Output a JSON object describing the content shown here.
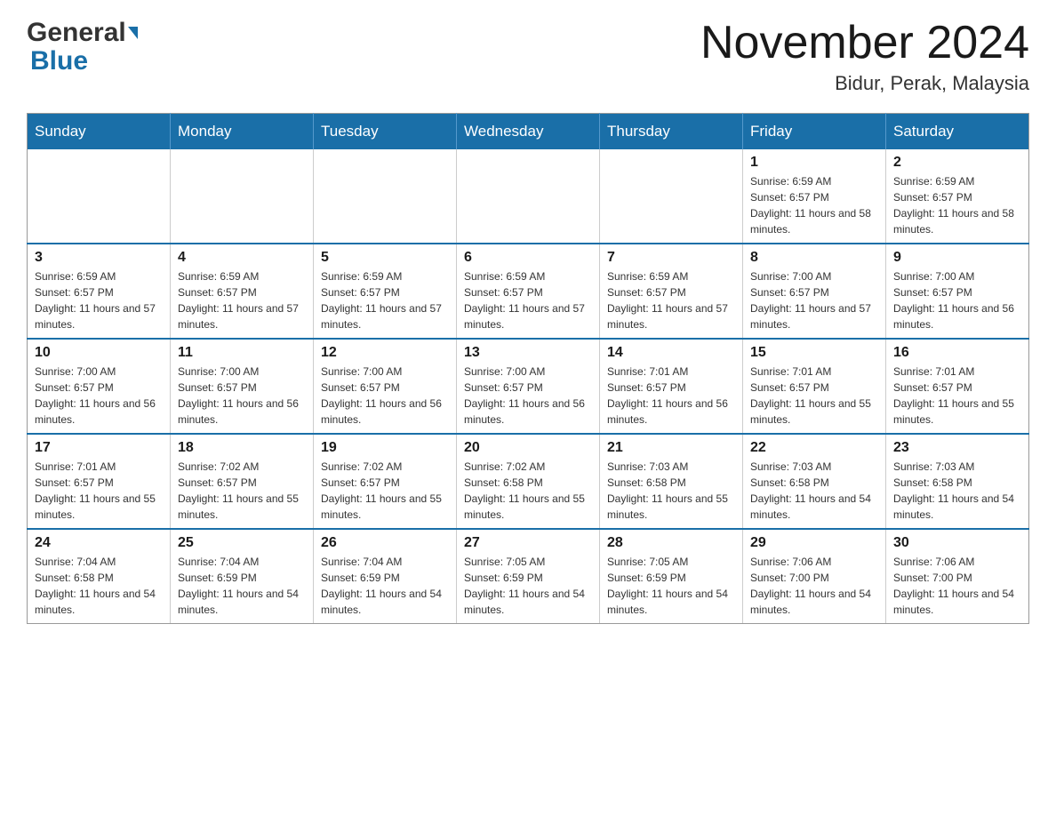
{
  "header": {
    "logo_general": "General",
    "logo_blue": "Blue",
    "month_title": "November 2024",
    "location": "Bidur, Perak, Malaysia"
  },
  "days_of_week": [
    "Sunday",
    "Monday",
    "Tuesday",
    "Wednesday",
    "Thursday",
    "Friday",
    "Saturday"
  ],
  "weeks": [
    [
      {
        "day": "",
        "sunrise": "",
        "sunset": "",
        "daylight": ""
      },
      {
        "day": "",
        "sunrise": "",
        "sunset": "",
        "daylight": ""
      },
      {
        "day": "",
        "sunrise": "",
        "sunset": "",
        "daylight": ""
      },
      {
        "day": "",
        "sunrise": "",
        "sunset": "",
        "daylight": ""
      },
      {
        "day": "",
        "sunrise": "",
        "sunset": "",
        "daylight": ""
      },
      {
        "day": "1",
        "sunrise": "Sunrise: 6:59 AM",
        "sunset": "Sunset: 6:57 PM",
        "daylight": "Daylight: 11 hours and 58 minutes."
      },
      {
        "day": "2",
        "sunrise": "Sunrise: 6:59 AM",
        "sunset": "Sunset: 6:57 PM",
        "daylight": "Daylight: 11 hours and 58 minutes."
      }
    ],
    [
      {
        "day": "3",
        "sunrise": "Sunrise: 6:59 AM",
        "sunset": "Sunset: 6:57 PM",
        "daylight": "Daylight: 11 hours and 57 minutes."
      },
      {
        "day": "4",
        "sunrise": "Sunrise: 6:59 AM",
        "sunset": "Sunset: 6:57 PM",
        "daylight": "Daylight: 11 hours and 57 minutes."
      },
      {
        "day": "5",
        "sunrise": "Sunrise: 6:59 AM",
        "sunset": "Sunset: 6:57 PM",
        "daylight": "Daylight: 11 hours and 57 minutes."
      },
      {
        "day": "6",
        "sunrise": "Sunrise: 6:59 AM",
        "sunset": "Sunset: 6:57 PM",
        "daylight": "Daylight: 11 hours and 57 minutes."
      },
      {
        "day": "7",
        "sunrise": "Sunrise: 6:59 AM",
        "sunset": "Sunset: 6:57 PM",
        "daylight": "Daylight: 11 hours and 57 minutes."
      },
      {
        "day": "8",
        "sunrise": "Sunrise: 7:00 AM",
        "sunset": "Sunset: 6:57 PM",
        "daylight": "Daylight: 11 hours and 57 minutes."
      },
      {
        "day": "9",
        "sunrise": "Sunrise: 7:00 AM",
        "sunset": "Sunset: 6:57 PM",
        "daylight": "Daylight: 11 hours and 56 minutes."
      }
    ],
    [
      {
        "day": "10",
        "sunrise": "Sunrise: 7:00 AM",
        "sunset": "Sunset: 6:57 PM",
        "daylight": "Daylight: 11 hours and 56 minutes."
      },
      {
        "day": "11",
        "sunrise": "Sunrise: 7:00 AM",
        "sunset": "Sunset: 6:57 PM",
        "daylight": "Daylight: 11 hours and 56 minutes."
      },
      {
        "day": "12",
        "sunrise": "Sunrise: 7:00 AM",
        "sunset": "Sunset: 6:57 PM",
        "daylight": "Daylight: 11 hours and 56 minutes."
      },
      {
        "day": "13",
        "sunrise": "Sunrise: 7:00 AM",
        "sunset": "Sunset: 6:57 PM",
        "daylight": "Daylight: 11 hours and 56 minutes."
      },
      {
        "day": "14",
        "sunrise": "Sunrise: 7:01 AM",
        "sunset": "Sunset: 6:57 PM",
        "daylight": "Daylight: 11 hours and 56 minutes."
      },
      {
        "day": "15",
        "sunrise": "Sunrise: 7:01 AM",
        "sunset": "Sunset: 6:57 PM",
        "daylight": "Daylight: 11 hours and 55 minutes."
      },
      {
        "day": "16",
        "sunrise": "Sunrise: 7:01 AM",
        "sunset": "Sunset: 6:57 PM",
        "daylight": "Daylight: 11 hours and 55 minutes."
      }
    ],
    [
      {
        "day": "17",
        "sunrise": "Sunrise: 7:01 AM",
        "sunset": "Sunset: 6:57 PM",
        "daylight": "Daylight: 11 hours and 55 minutes."
      },
      {
        "day": "18",
        "sunrise": "Sunrise: 7:02 AM",
        "sunset": "Sunset: 6:57 PM",
        "daylight": "Daylight: 11 hours and 55 minutes."
      },
      {
        "day": "19",
        "sunrise": "Sunrise: 7:02 AM",
        "sunset": "Sunset: 6:57 PM",
        "daylight": "Daylight: 11 hours and 55 minutes."
      },
      {
        "day": "20",
        "sunrise": "Sunrise: 7:02 AM",
        "sunset": "Sunset: 6:58 PM",
        "daylight": "Daylight: 11 hours and 55 minutes."
      },
      {
        "day": "21",
        "sunrise": "Sunrise: 7:03 AM",
        "sunset": "Sunset: 6:58 PM",
        "daylight": "Daylight: 11 hours and 55 minutes."
      },
      {
        "day": "22",
        "sunrise": "Sunrise: 7:03 AM",
        "sunset": "Sunset: 6:58 PM",
        "daylight": "Daylight: 11 hours and 54 minutes."
      },
      {
        "day": "23",
        "sunrise": "Sunrise: 7:03 AM",
        "sunset": "Sunset: 6:58 PM",
        "daylight": "Daylight: 11 hours and 54 minutes."
      }
    ],
    [
      {
        "day": "24",
        "sunrise": "Sunrise: 7:04 AM",
        "sunset": "Sunset: 6:58 PM",
        "daylight": "Daylight: 11 hours and 54 minutes."
      },
      {
        "day": "25",
        "sunrise": "Sunrise: 7:04 AM",
        "sunset": "Sunset: 6:59 PM",
        "daylight": "Daylight: 11 hours and 54 minutes."
      },
      {
        "day": "26",
        "sunrise": "Sunrise: 7:04 AM",
        "sunset": "Sunset: 6:59 PM",
        "daylight": "Daylight: 11 hours and 54 minutes."
      },
      {
        "day": "27",
        "sunrise": "Sunrise: 7:05 AM",
        "sunset": "Sunset: 6:59 PM",
        "daylight": "Daylight: 11 hours and 54 minutes."
      },
      {
        "day": "28",
        "sunrise": "Sunrise: 7:05 AM",
        "sunset": "Sunset: 6:59 PM",
        "daylight": "Daylight: 11 hours and 54 minutes."
      },
      {
        "day": "29",
        "sunrise": "Sunrise: 7:06 AM",
        "sunset": "Sunset: 7:00 PM",
        "daylight": "Daylight: 11 hours and 54 minutes."
      },
      {
        "day": "30",
        "sunrise": "Sunrise: 7:06 AM",
        "sunset": "Sunset: 7:00 PM",
        "daylight": "Daylight: 11 hours and 54 minutes."
      }
    ]
  ]
}
